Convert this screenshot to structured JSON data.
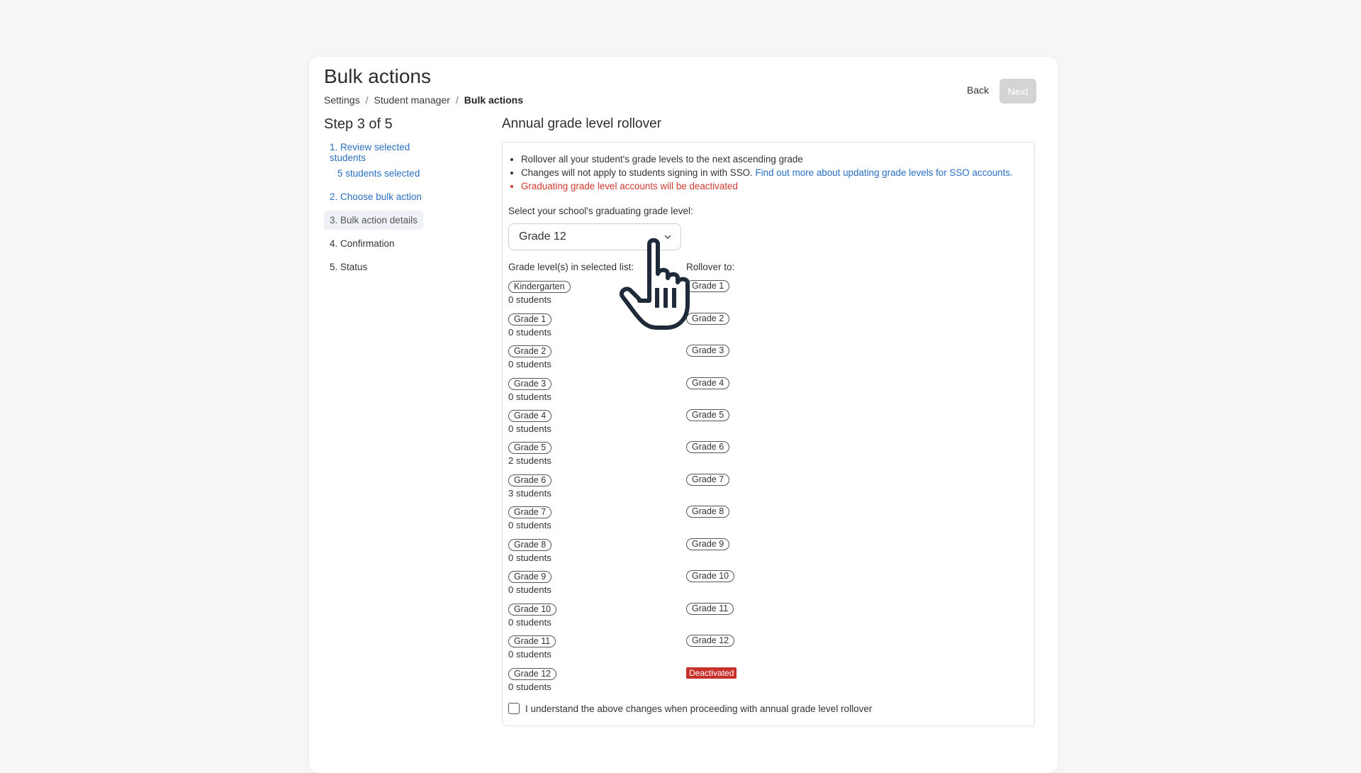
{
  "header": {
    "title": "Bulk actions",
    "breadcrumb": [
      "Settings",
      "Student manager",
      "Bulk actions"
    ],
    "back_label": "Back",
    "next_label": "Next"
  },
  "steps": {
    "title": "Step 3 of 5",
    "items": [
      {
        "label": "1. Review selected students",
        "sub": "5 students selected"
      },
      {
        "label": "2. Choose bulk action"
      },
      {
        "label": "3. Bulk action details"
      },
      {
        "label": "4. Confirmation"
      },
      {
        "label": "5. Status"
      }
    ]
  },
  "section": {
    "title": "Annual grade level rollover",
    "bullets": [
      "Rollover all your student's grade levels to the next ascending grade",
      "Changes will not apply to students signing in with SSO.",
      "Graduating grade level accounts will be deactivated"
    ],
    "sso_link": "Find out more about updating grade levels for SSO accounts."
  },
  "select": {
    "label": "Select your school's graduating grade level:",
    "value": "Grade 12"
  },
  "columns": {
    "current": "Grade level(s) in selected list:",
    "target": "Rollover to:"
  },
  "grades": [
    {
      "current": "Kindergarten",
      "count": "0 students",
      "target": "Grade 1"
    },
    {
      "current": "Grade 1",
      "count": "0 students",
      "target": "Grade 2"
    },
    {
      "current": "Grade 2",
      "count": "0 students",
      "target": "Grade 3"
    },
    {
      "current": "Grade 3",
      "count": "0 students",
      "target": "Grade 4"
    },
    {
      "current": "Grade 4",
      "count": "0 students",
      "target": "Grade 5"
    },
    {
      "current": "Grade 5",
      "count": "2 students",
      "target": "Grade 6"
    },
    {
      "current": "Grade 6",
      "count": "3 students",
      "target": "Grade 7"
    },
    {
      "current": "Grade 7",
      "count": "0 students",
      "target": "Grade 8"
    },
    {
      "current": "Grade 8",
      "count": "0 students",
      "target": "Grade 9"
    },
    {
      "current": "Grade 9",
      "count": "0 students",
      "target": "Grade 10"
    },
    {
      "current": "Grade 10",
      "count": "0 students",
      "target": "Grade 11"
    },
    {
      "current": "Grade 11",
      "count": "0 students",
      "target": "Grade 12"
    },
    {
      "current": "Grade 12",
      "count": "0 students",
      "target": "Deactivated"
    }
  ],
  "acknowledge": {
    "label": "I understand the above changes when proceeding with annual grade level rollover"
  },
  "colors": {
    "link": "#2a6fc2",
    "warning": "#d03a2f",
    "deactivated": "#c8302c",
    "next_disabled": "#d4d4d4"
  },
  "icons": {
    "select_chevron": "chevron-down-icon",
    "pointer": "hand-pointer-icon"
  }
}
